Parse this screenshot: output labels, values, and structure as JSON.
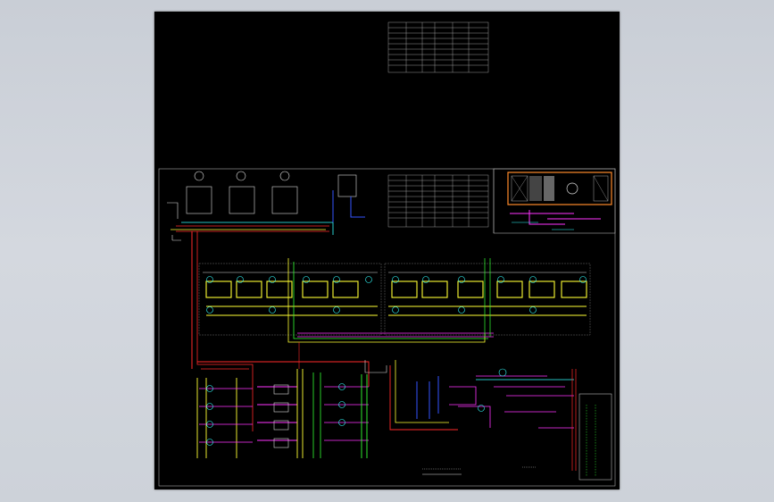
{
  "viewer": {
    "background_color": "#cdd2d9",
    "sheet_color": "#000000"
  },
  "drawing": {
    "table_top_title": "",
    "table_mid_title": "",
    "bottom_caption": "",
    "ahu_label": "",
    "colors": {
      "supply_red": "#ff2a2a",
      "return_yellow": "#ffff33",
      "magenta": "#ff33ff",
      "green": "#33ff33",
      "cyan": "#33ffff",
      "blue": "#3355ff",
      "orange": "#ff8a2a",
      "white": "#ffffff",
      "gray": "#888888"
    }
  }
}
